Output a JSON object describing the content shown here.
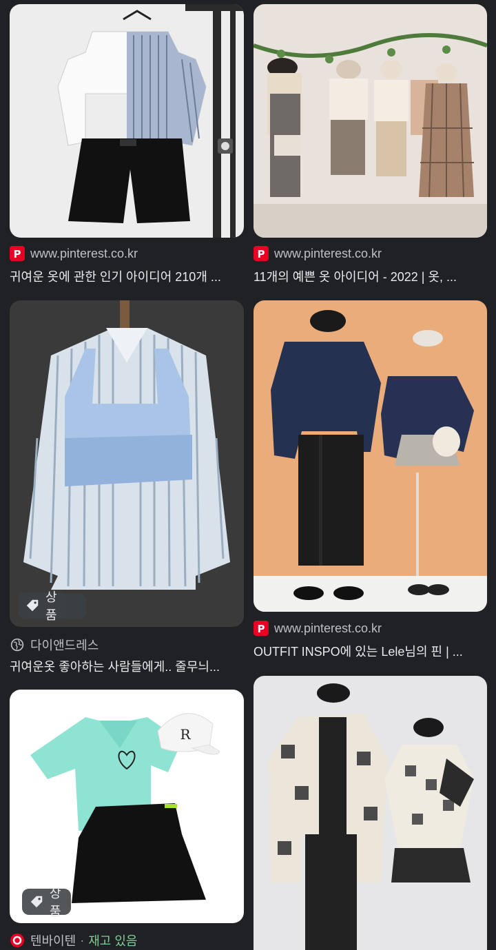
{
  "results": [
    {
      "source": "www.pinterest.co.kr",
      "title": "귀여운 옷에 관한 인기 아이디어 210개 ...",
      "icon": "pinterest-icon"
    },
    {
      "source": "www.pinterest.co.kr",
      "title": "11개의 예쁜 옷 아이디어 - 2022 | 옷, ...",
      "icon": "pinterest-icon"
    },
    {
      "source": "다이앤드레스",
      "title": "귀여운옷 좋아하는 사람들에게.. 줄무늬...",
      "icon": "globe-icon",
      "badge": "상품"
    },
    {
      "source": "www.pinterest.co.kr",
      "title": "OUTFIT INSPO에 있는 Lele님의 핀 | ...",
      "icon": "pinterest-icon"
    },
    {
      "source": "텐바이텐",
      "stock": "재고 있음",
      "icon": "tenbyten-icon",
      "badge": "상품"
    },
    {
      "source": "",
      "title": ""
    }
  ],
  "colors": {
    "background": "#202124",
    "pinterest": "#e60023",
    "stock_green": "#81c995"
  }
}
